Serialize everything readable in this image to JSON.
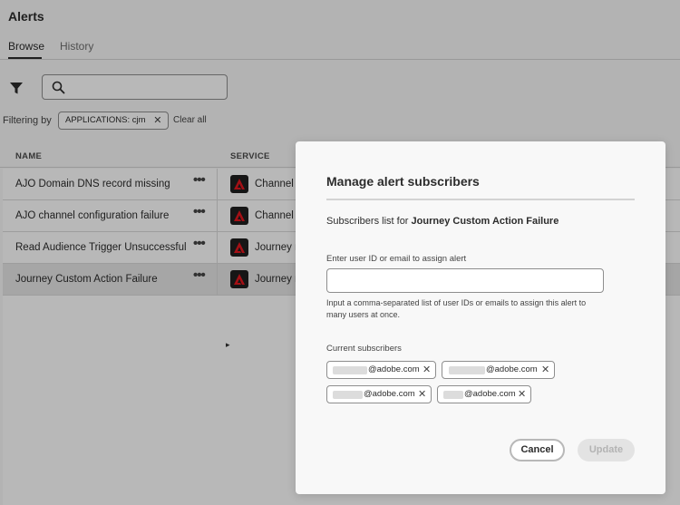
{
  "page": {
    "title": "Alerts",
    "tabs": [
      {
        "label": "Browse",
        "selected": true
      },
      {
        "label": "History",
        "selected": false
      }
    ]
  },
  "toolbar": {
    "filter_icon": "filter-icon",
    "search_icon": "search-icon",
    "search_value": ""
  },
  "filters": {
    "label": "Filtering by",
    "chip": "APPLICATIONS: cjm",
    "clear_label": "Clear all"
  },
  "table": {
    "columns": [
      "NAME",
      "SERVICE"
    ],
    "rows": [
      {
        "name": "AJO Domain DNS record missing",
        "service": "Channel i",
        "selected": false
      },
      {
        "name": "AJO channel configuration failure",
        "service": "Channel i",
        "selected": false
      },
      {
        "name": "Read Audience Trigger Unsuccessful",
        "service": "Journey r",
        "selected": false
      },
      {
        "name": "Journey Custom Action Failure",
        "service": "Journey r",
        "selected": true
      }
    ],
    "more_label": "•••"
  },
  "dialog": {
    "title": "Manage alert subscribers",
    "subscribers_prefix": "Subscribers list for ",
    "alert_name": "Journey Custom Action Failure",
    "input_label": "Enter user ID or email to assign alert",
    "input_value": "",
    "help_text": "Input a comma-separated list of user IDs or emails to assign this alert to many users at once.",
    "current_label": "Current subscribers",
    "subscribers": [
      {
        "email": "@adobe.com"
      },
      {
        "email": "@adobe.com"
      },
      {
        "email": "@adobe.com"
      },
      {
        "email": "@adobe.com"
      }
    ],
    "remove_glyph": "✕",
    "cancel_label": "Cancel",
    "update_label": "Update"
  },
  "colors": {
    "overlay": "#000000",
    "service_icon_bg": "#1f1f1f",
    "service_icon_fg": "#e3171e"
  }
}
